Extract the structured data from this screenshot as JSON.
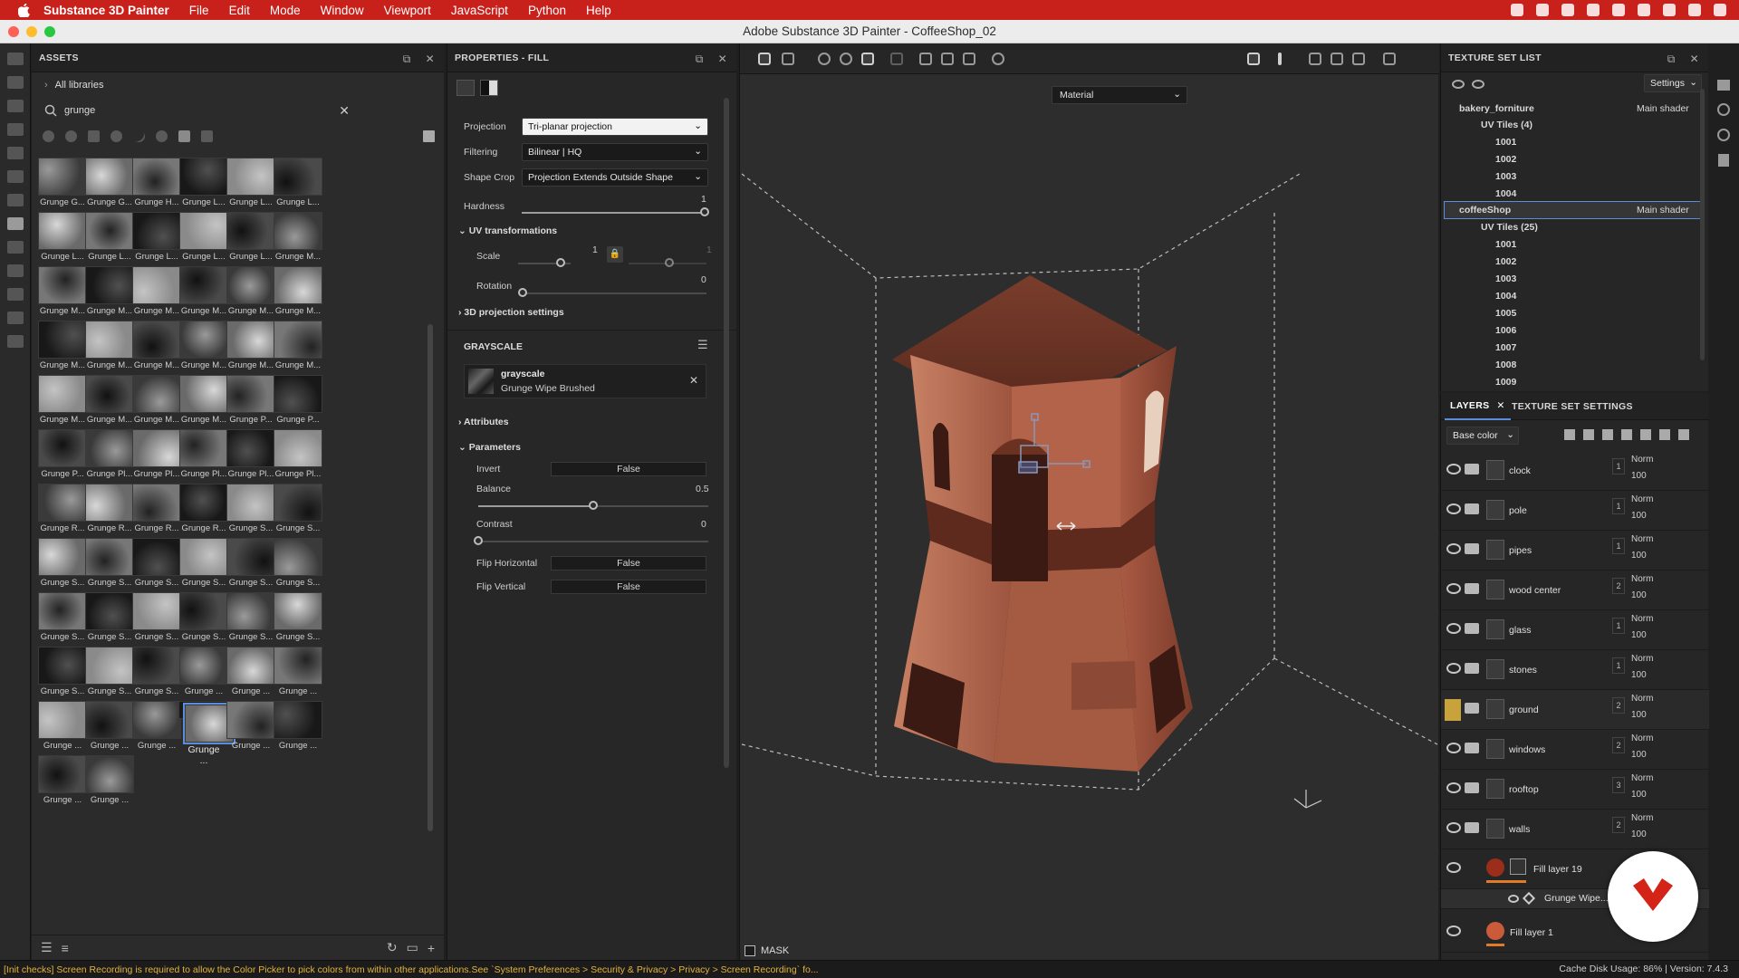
{
  "menubar": {
    "app": "Substance 3D Painter",
    "items": [
      "File",
      "Edit",
      "Mode",
      "Window",
      "Viewport",
      "JavaScript",
      "Python",
      "Help"
    ]
  },
  "window": {
    "title": "Adobe Substance 3D Painter - CoffeeShop_02"
  },
  "assets": {
    "title": "ASSETS",
    "libraries": "All libraries",
    "search_value": "grunge",
    "tiles": [
      "Grunge G...",
      "Grunge G...",
      "Grunge H...",
      "Grunge L...",
      "Grunge L...",
      "Grunge L...",
      "Grunge L...",
      "Grunge L...",
      "Grunge L...",
      "Grunge L...",
      "Grunge L...",
      "Grunge M...",
      "Grunge M...",
      "Grunge M...",
      "Grunge M...",
      "Grunge M...",
      "Grunge M...",
      "Grunge M...",
      "Grunge M...",
      "Grunge M...",
      "Grunge M...",
      "Grunge M...",
      "Grunge M...",
      "Grunge M...",
      "Grunge M...",
      "Grunge M...",
      "Grunge M...",
      "Grunge M...",
      "Grunge P...",
      "Grunge P...",
      "Grunge P...",
      "Grunge Pl...",
      "Grunge Pl...",
      "Grunge Pl...",
      "Grunge Pl...",
      "Grunge Pl...",
      "Grunge R...",
      "Grunge R...",
      "Grunge R...",
      "Grunge R...",
      "Grunge S...",
      "Grunge S...",
      "Grunge S...",
      "Grunge S...",
      "Grunge S...",
      "Grunge S...",
      "Grunge S...",
      "Grunge S...",
      "Grunge S...",
      "Grunge S...",
      "Grunge S...",
      "Grunge S...",
      "Grunge S...",
      "Grunge S...",
      "Grunge S...",
      "Grunge S...",
      "Grunge S...",
      "Grunge ...",
      "Grunge ...",
      "Grunge ...",
      "Grunge ...",
      "Grunge ...",
      "Grunge ...",
      "Grunge ...",
      "Grunge ...",
      "Grunge ...",
      "Grunge ...",
      "Grunge ..."
    ]
  },
  "properties": {
    "title": "PROPERTIES - FILL",
    "projection_label": "Projection",
    "projection_value": "Tri-planar projection",
    "filtering_label": "Filtering",
    "filtering_value": "Bilinear | HQ",
    "shapecrop_label": "Shape Crop",
    "shapecrop_value": "Projection Extends Outside Shape",
    "hardness_label": "Hardness",
    "hardness_value": "1",
    "uv_section": "UV transformations",
    "scale_label": "Scale",
    "scale_value": "1",
    "scale_value2": "1",
    "rotation_label": "Rotation",
    "rotation_value": "0",
    "proj3d_section": "3D projection settings",
    "grayscale_header": "GRAYSCALE",
    "resource_name": "grayscale",
    "resource_sub": "Grunge Wipe Brushed",
    "attributes_section": "Attributes",
    "parameters_section": "Parameters",
    "invert_label": "Invert",
    "invert_value": "False",
    "balance_label": "Balance",
    "balance_value": "0.5",
    "contrast_label": "Contrast",
    "contrast_value": "0",
    "fliph_label": "Flip Horizontal",
    "fliph_value": "False",
    "flipv_label": "Flip Vertical",
    "flipv_value": "False",
    "hardness_level": 1.0,
    "balance_level": 0.5,
    "contrast_level": 0.0
  },
  "viewport": {
    "material_mode": "Material",
    "mask_label": "MASK"
  },
  "texture_set_list": {
    "title": "TEXTURE SET LIST",
    "settings": "Settings",
    "sets": [
      {
        "name": "bakery_forniture",
        "shader": "Main shader",
        "uv_label": "UV Tiles (4)",
        "tiles": [
          "1001",
          "1002",
          "1003",
          "1004"
        ]
      },
      {
        "name": "coffeeShop",
        "shader": "Main shader",
        "uv_label": "UV Tiles (25)",
        "tiles": [
          "1001",
          "1002",
          "1003",
          "1004",
          "1005",
          "1006",
          "1007",
          "1008",
          "1009"
        ]
      }
    ]
  },
  "layers": {
    "tab_layers": "LAYERS",
    "tab_settings": "TEXTURE SET SETTINGS",
    "channel": "Base color",
    "rows": [
      {
        "name": "clock",
        "count": "1",
        "blend": "Norm",
        "opacity": "100"
      },
      {
        "name": "pole",
        "count": "1",
        "blend": "Norm",
        "opacity": "100"
      },
      {
        "name": "pipes",
        "count": "1",
        "blend": "Norm",
        "opacity": "100"
      },
      {
        "name": "wood center",
        "count": "2",
        "blend": "Norm",
        "opacity": "100"
      },
      {
        "name": "glass",
        "count": "1",
        "blend": "Norm",
        "opacity": "100"
      },
      {
        "name": "stones",
        "count": "1",
        "blend": "Norm",
        "opacity": "100"
      },
      {
        "name": "ground",
        "count": "2",
        "blend": "Norm",
        "opacity": "100"
      },
      {
        "name": "windows",
        "count": "2",
        "blend": "Norm",
        "opacity": "100"
      },
      {
        "name": "rooftop",
        "count": "3",
        "blend": "Norm",
        "opacity": "100"
      },
      {
        "name": "walls",
        "count": "2",
        "blend": "Norm",
        "opacity": "100"
      }
    ],
    "fill_layer_19": "Fill layer 19",
    "grunge_mask": "Grunge Wipe...",
    "fill_layer_1": "Fill layer 1"
  },
  "status": {
    "message": "[Init checks] Screen Recording is required to allow the Color Picker to pick colors from within other applications.See `System Preferences > Security & Privacy > Privacy > Screen Recording` fo...",
    "cache": "Cache Disk Usage:   86% | Version: 7.4.3"
  }
}
